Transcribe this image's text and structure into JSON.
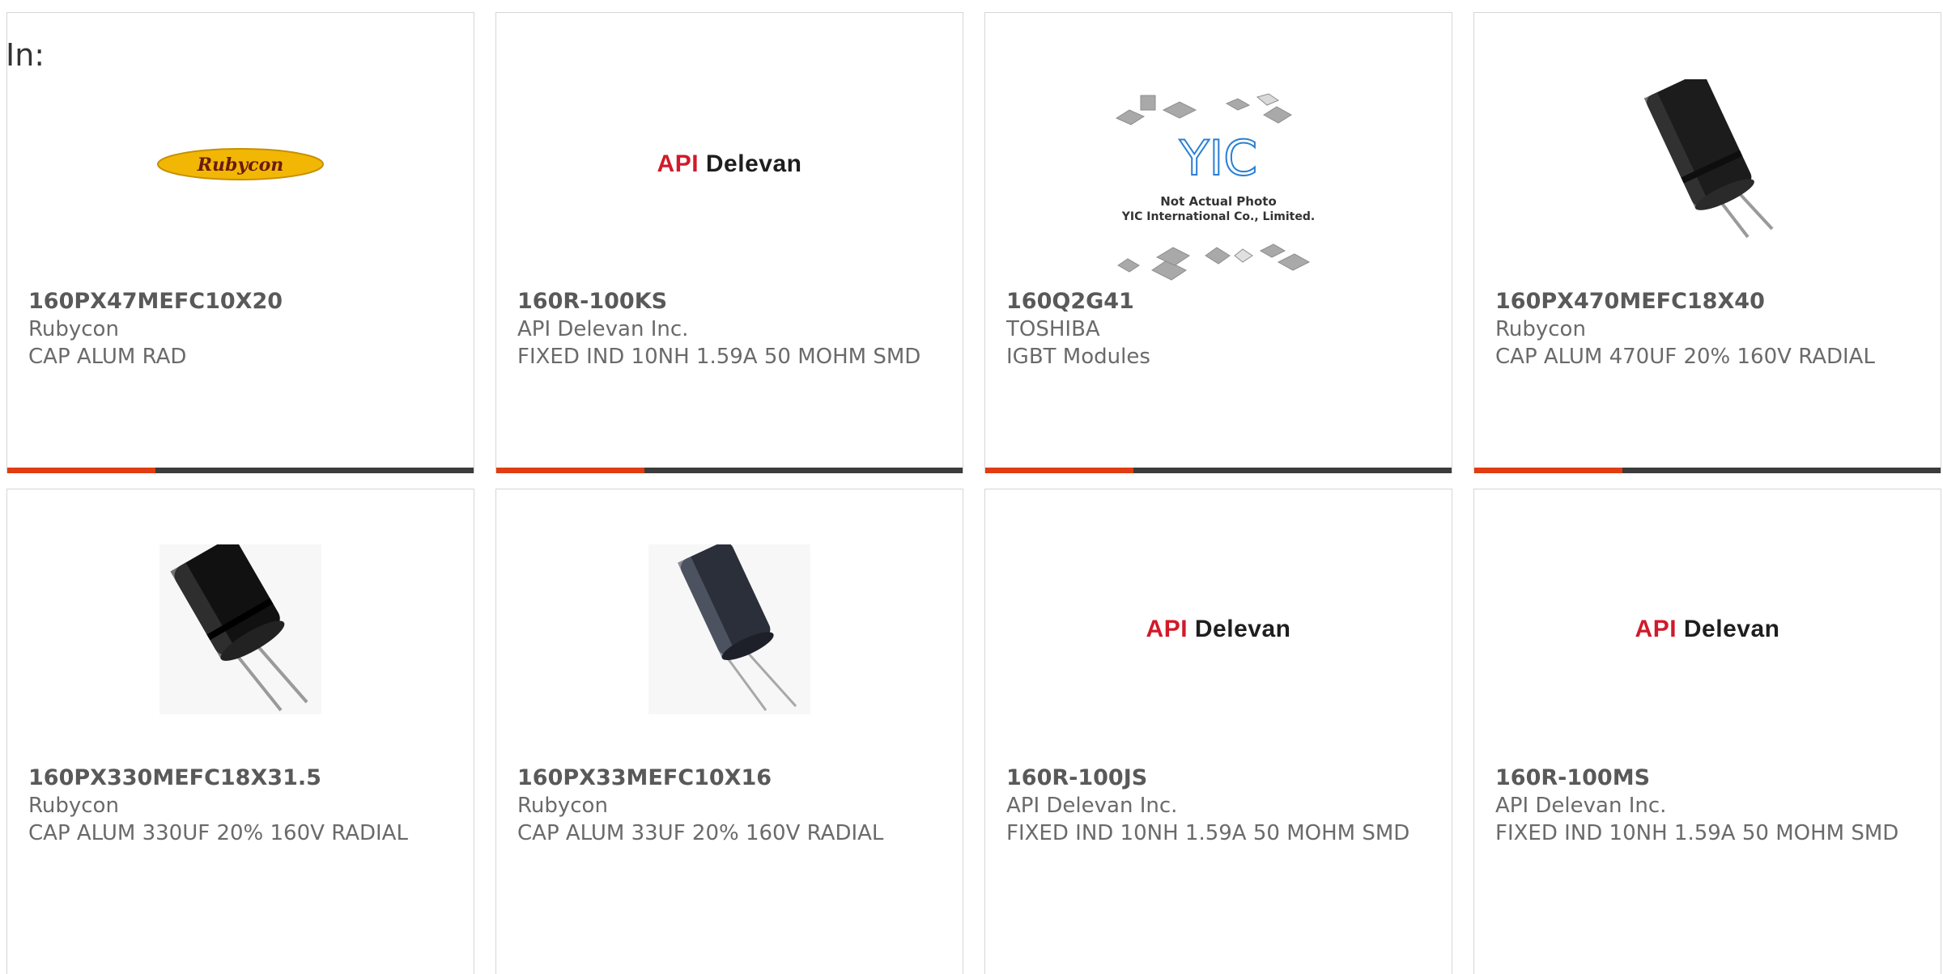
{
  "in_label": "In:",
  "colors": {
    "accent_orange": "#e03d12",
    "accent_dark": "#3c3c3c"
  },
  "products": [
    {
      "part_number": "160PX47MEFC10X20",
      "manufacturer": "Rubycon",
      "description": "CAP ALUM RAD",
      "image": "rubycon-logo",
      "logo_text": "Rubycon"
    },
    {
      "part_number": "160R-100KS",
      "manufacturer": "API Delevan Inc.",
      "description": "FIXED IND 10NH 1.59A 50 MOHM SMD",
      "image": "api-delevan-logo",
      "logo_text_red": "API",
      "logo_text_black": "Delevan"
    },
    {
      "part_number": "160Q2G41",
      "manufacturer": "TOSHIBA",
      "description": "IGBT Modules",
      "image": "yic-placeholder",
      "logo_text": "YIC",
      "caption_1": "Not Actual Photo",
      "caption_2": "YIC International Co., Limited."
    },
    {
      "part_number": "160PX470MEFC18X40",
      "manufacturer": "Rubycon",
      "description": "CAP ALUM 470UF 20% 160V RADIAL",
      "image": "capacitor-photo"
    },
    {
      "part_number": "160PX330MEFC18X31.5",
      "manufacturer": "Rubycon",
      "description": "CAP ALUM 330UF 20% 160V RADIAL",
      "image": "capacitor-photo"
    },
    {
      "part_number": "160PX33MEFC10X16",
      "manufacturer": "Rubycon",
      "description": "CAP ALUM 33UF 20% 160V RADIAL",
      "image": "capacitor-photo"
    },
    {
      "part_number": "160R-100JS",
      "manufacturer": "API Delevan Inc.",
      "description": "FIXED IND 10NH 1.59A 50 MOHM SMD",
      "image": "api-delevan-logo",
      "logo_text_red": "API",
      "logo_text_black": "Delevan"
    },
    {
      "part_number": "160R-100MS",
      "manufacturer": "API Delevan Inc.",
      "description": "FIXED IND 10NH 1.59A 50 MOHM SMD",
      "image": "api-delevan-logo",
      "logo_text_red": "API",
      "logo_text_black": "Delevan"
    }
  ]
}
